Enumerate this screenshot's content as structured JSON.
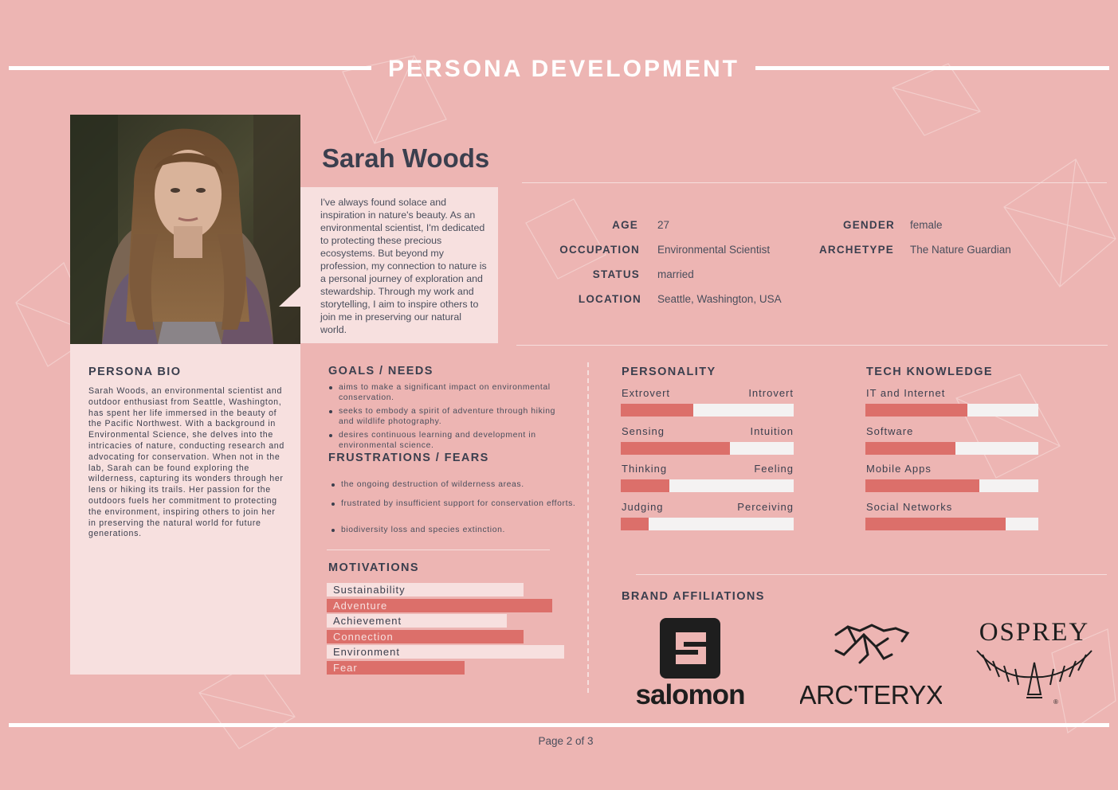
{
  "header": {
    "title": "PERSONA DEVELOPMENT"
  },
  "persona": {
    "name": "Sarah Woods",
    "quote": "I've always found solace and inspiration in nature's beauty. As an environmental scientist, I'm dedicated to protecting these precious ecosystems. But beyond my profession, my connection to nature is a personal journey of exploration and stewardship. Through my work and storytelling, I aim to inspire others to join me in preserving our natural world."
  },
  "demographics": {
    "age_label": "AGE",
    "age": "27",
    "gender_label": "GENDER",
    "gender": "female",
    "occupation_label": "OCCUPATION",
    "occupation": "Environmental Scientist",
    "archetype_label": "ARCHETYPE",
    "archetype": "The Nature Guardian",
    "status_label": "STATUS",
    "status": "married",
    "location_label": "LOCATION",
    "location": "Seattle, Washington, USA"
  },
  "bio": {
    "title": "PERSONA BIO",
    "text": "Sarah Woods, an environmental scientist and outdoor enthusiast from Seattle, Washington, has spent her life immersed in the beauty of the Pacific Northwest. With a background in Environmental Science, she delves into the intricacies of nature, conducting research and advocating for conservation. When not in the lab, Sarah can be found exploring the wilderness, capturing its wonders through her lens or hiking its trails. Her passion for the outdoors fuels her commitment to protecting the environment, inspiring others to join her in preserving the natural world for future generations."
  },
  "goals": {
    "title": "GOALS / NEEDS",
    "items": [
      "aims to make a significant impact on environmental conservation.",
      "seeks to embody a spirit of adventure through hiking and wildlife photography.",
      "desires continuous learning and development in environmental science."
    ]
  },
  "frustrations": {
    "title": "FRUSTRATIONS / FEARS",
    "items": [
      "the ongoing destruction of wilderness areas.",
      "frustrated by insufficient support for conservation efforts.",
      "biodiversity loss and species extinction."
    ]
  },
  "motivations": {
    "title": "MOTIVATIONS",
    "items": [
      {
        "label": "Sustainability",
        "level": 0.83
      },
      {
        "label": "Adventure",
        "level": 0.95
      },
      {
        "label": "Achievement",
        "level": 0.76
      },
      {
        "label": "Connection",
        "level": 0.83
      },
      {
        "label": "Environment",
        "level": 1.0
      },
      {
        "label": "Fear",
        "level": 0.58
      }
    ]
  },
  "personality": {
    "title": "PERSONALITY",
    "traits": [
      {
        "left": "Extrovert",
        "right": "Introvert",
        "level": 0.42
      },
      {
        "left": "Sensing",
        "right": "Intuition",
        "level": 0.63
      },
      {
        "left": "Thinking",
        "right": "Feeling",
        "level": 0.28
      },
      {
        "left": "Judging",
        "right": "Perceiving",
        "level": 0.16
      }
    ]
  },
  "tech": {
    "title": "TECH KNOWLEDGE",
    "items": [
      {
        "label": "IT and Internet",
        "level": 0.59
      },
      {
        "label": "Software",
        "level": 0.52
      },
      {
        "label": "Mobile Apps",
        "level": 0.66
      },
      {
        "label": "Social Networks",
        "level": 0.81
      }
    ]
  },
  "brands": {
    "title": "BRAND AFFILIATIONS",
    "salomon": "salomon",
    "arcteryx": "ARC'TERYX",
    "osprey": "OSPREY"
  },
  "footer": {
    "page": "Page 2  of 3"
  },
  "colors": {
    "background": "#edb5b3",
    "panel": "#f7e0df",
    "accent": "#dc6f6a",
    "text": "#3b3f4e"
  }
}
